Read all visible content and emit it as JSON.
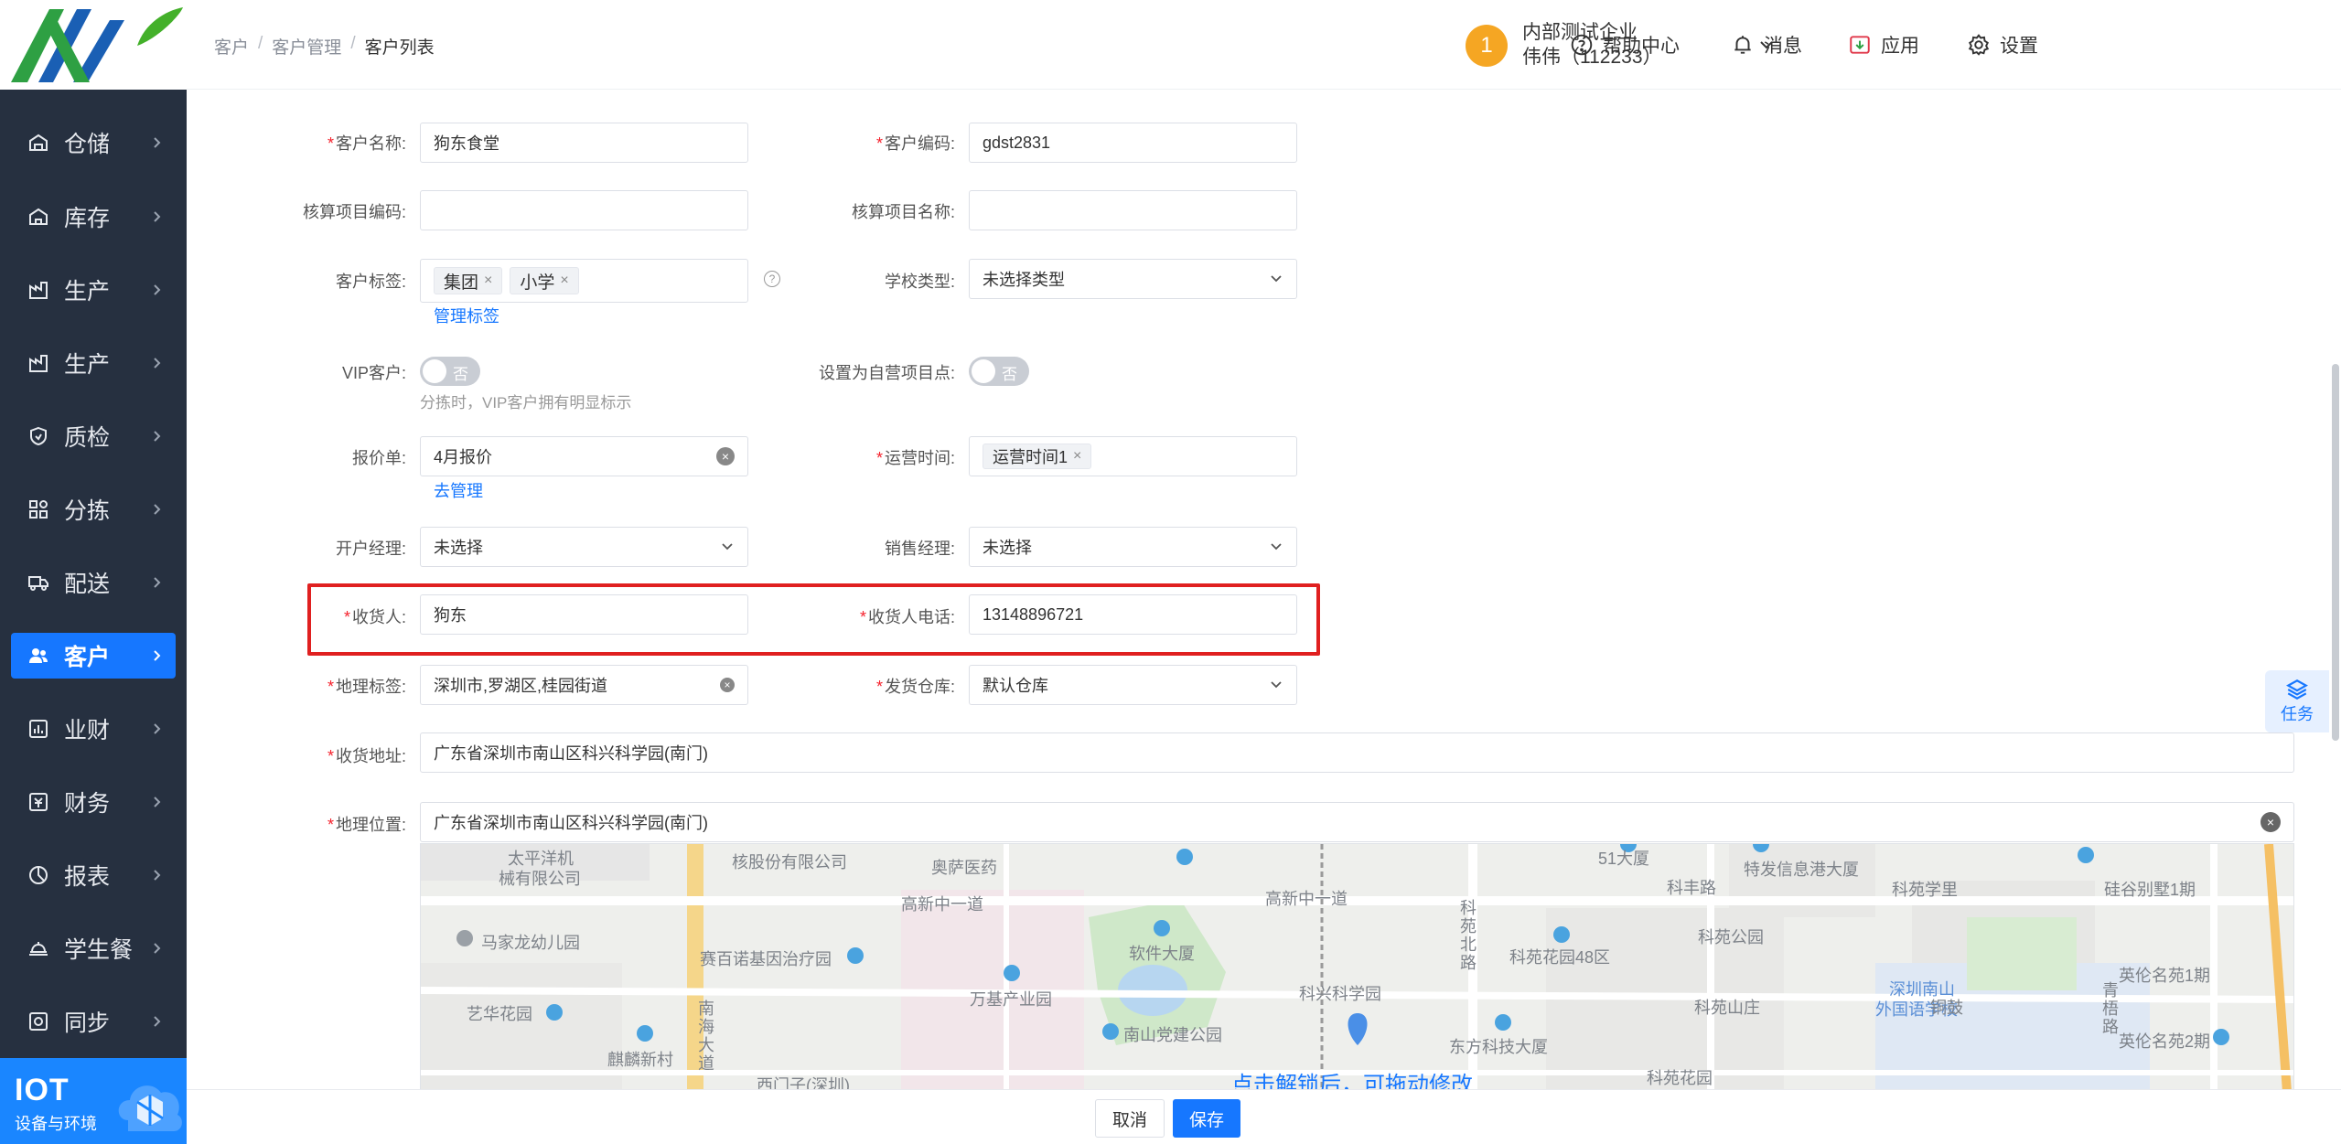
{
  "breadcrumb": [
    "客户",
    "客户管理",
    "客户列表"
  ],
  "header": {
    "help": "帮助中心",
    "messages": "消息",
    "apps": "应用",
    "settings": "设置",
    "avatar": "1",
    "company": "内部测试企业",
    "user": "伟伟（112233）"
  },
  "sidebar": {
    "items": [
      {
        "label": "仓储",
        "icon": "warehouse-icon"
      },
      {
        "label": "库存",
        "icon": "inventory-icon"
      },
      {
        "label": "生产",
        "icon": "factory-icon"
      },
      {
        "label": "生产",
        "icon": "factory-icon"
      },
      {
        "label": "质检",
        "icon": "shield-icon"
      },
      {
        "label": "分拣",
        "icon": "sort-icon"
      },
      {
        "label": "配送",
        "icon": "truck-icon"
      },
      {
        "label": "客户",
        "icon": "users-icon"
      },
      {
        "label": "业财",
        "icon": "chart-icon"
      },
      {
        "label": "财务",
        "icon": "finance-icon"
      },
      {
        "label": "报表",
        "icon": "pie-icon"
      },
      {
        "label": "学生餐",
        "icon": "meal-icon"
      },
      {
        "label": "同步",
        "icon": "sync-icon"
      }
    ],
    "active_index": 7,
    "iot_title": "IOT",
    "iot_subtitle": "设备与环境"
  },
  "form": {
    "customer_name_label": "客户名称:",
    "customer_name": "狗东食堂",
    "customer_code_label": "客户编码:",
    "customer_code": "gdst2831",
    "acct_code_label": "核算项目编码:",
    "acct_code": "",
    "acct_name_label": "核算项目名称:",
    "acct_name": "",
    "tags_label": "客户标签:",
    "tags": [
      "集团",
      "小学"
    ],
    "manage_tags": "管理标签",
    "school_type_label": "学校类型:",
    "school_type": "未选择类型",
    "vip_label": "VIP客户:",
    "vip_state": "否",
    "vip_hint": "分拣时，VIP客户拥有明显标示",
    "self_op_label": "设置为自营项目点:",
    "self_op_state": "否",
    "quote_label": "报价单:",
    "quote": "4月报价",
    "quote_manage": "去管理",
    "op_time_label": "运营时间:",
    "op_time_tag": "运营时间1",
    "acct_mgr_label": "开户经理:",
    "acct_mgr": "未选择",
    "sales_mgr_label": "销售经理:",
    "sales_mgr": "未选择",
    "receiver_label": "收货人:",
    "receiver": "狗东",
    "receiver_phone_label": "收货人电话:",
    "receiver_phone": "13148896721",
    "geo_tag_label": "地理标签:",
    "geo_tag": "深圳市,罗湖区,桂园街道",
    "ship_wh_label": "发货仓库:",
    "ship_wh": "默认仓库",
    "address_label": "收货地址:",
    "address": "广东省深圳市南山区科兴科学园(南门)",
    "location_label": "地理位置:",
    "location": "广东省深圳市南山区科兴科学园(南门)"
  },
  "map": {
    "labels": [
      "太平洋机",
      "械有限公司",
      "核股份有限公司",
      "奥萨医药",
      "高新中一道",
      "51大厦",
      "特发信息港大厦",
      "科丰路",
      "科苑学里",
      "硅谷别墅1期",
      "马家龙幼儿园",
      "赛百诺基因治疗园",
      "软件大厦",
      "高新中一道",
      "科苑花园48区",
      "科苑公园",
      "万基产业园",
      "科兴科学园",
      "深圳南山",
      "外国语学校",
      "英伦名苑1期",
      "艺华花园",
      "南山党建公园",
      "科苑山庄",
      "铜鼓",
      "麒麟新村",
      "东方科技大厦",
      "英伦名苑2期",
      "西门子(深圳)",
      "科苑花园",
      "南海大道",
      "科苑北路",
      "青梧路"
    ],
    "hint": "点击解锁后，可拖动修改"
  },
  "footer": {
    "cancel": "取消",
    "save": "保存"
  },
  "task_float": "任务"
}
